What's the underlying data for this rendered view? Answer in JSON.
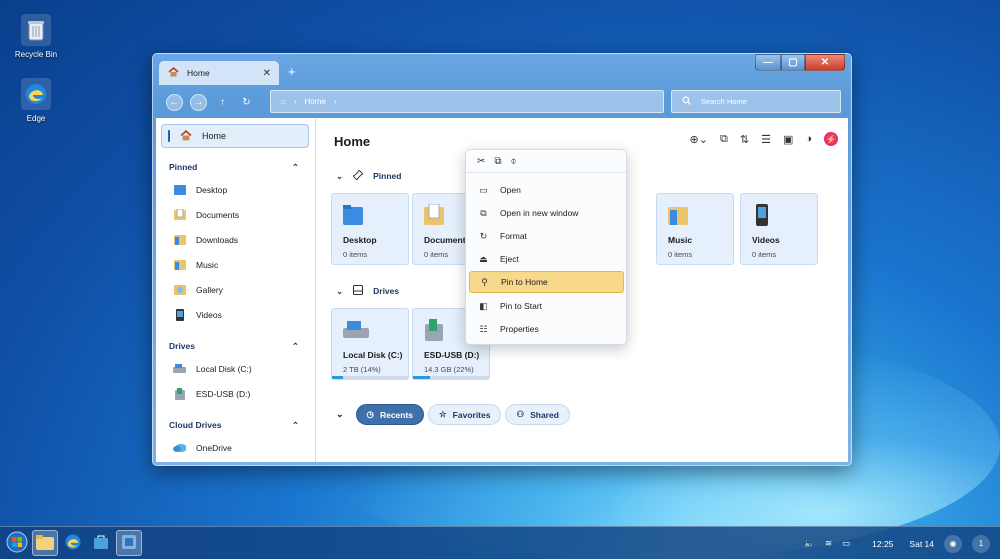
{
  "desktop": {
    "icons": [
      {
        "label": "Recycle Bin",
        "icon": "recycle-bin-icon"
      },
      {
        "label": "Edge",
        "icon": "edge-icon"
      }
    ]
  },
  "window": {
    "tab_label": "Home",
    "tab_close": "✕",
    "new_tab": "+",
    "controls": {
      "minimize": "—",
      "maximize": "▢",
      "close": "✕"
    }
  },
  "navbar": {
    "breadcrumb_sep1": "›",
    "breadcrumb": "Home",
    "breadcrumb_sep2": "›",
    "search_placeholder": "Search Home"
  },
  "sidebar": {
    "home": "Home",
    "pinned_header": "Pinned",
    "pinned": [
      "Desktop",
      "Documents",
      "Downloads",
      "Music",
      "Gallery",
      "Videos"
    ],
    "drives_header": "Drives",
    "drives": [
      "Local Disk (C:)",
      "ESD-USB (D:)"
    ],
    "cloud_header": "Cloud Drives",
    "cloud": [
      "OneDrive"
    ],
    "chevron": "⌃"
  },
  "main": {
    "title": "Home",
    "pinned_header": "Pinned",
    "drives_header": "Drives",
    "pinned_cards": [
      {
        "name": "Desktop",
        "sub": "0 items"
      },
      {
        "name": "Documents",
        "sub": "0 items"
      },
      {
        "name": "Music",
        "sub": "0 items"
      },
      {
        "name": "Videos",
        "sub": "0 items"
      }
    ],
    "drive_cards": [
      {
        "name": "Local Disk (C:)",
        "sub": "2 TB (14%)",
        "usage": 0.14
      },
      {
        "name": "ESD-USB (D:)",
        "sub": "14.3 GB (22%)",
        "usage": 0.22
      }
    ],
    "pills": {
      "recents": "Recents",
      "favorites": "Favorites",
      "shared": "Shared"
    },
    "collapse": "⌄"
  },
  "context_menu": {
    "items": [
      "Open",
      "Open in new window",
      "Format",
      "Eject",
      "Pin to Home",
      "Pin to Start",
      "Properties"
    ],
    "highlighted": "Pin to Home"
  },
  "taskbar": {
    "time": "12:25",
    "date": "Sat 14",
    "notification_count": "1"
  },
  "colors": {
    "accent": "#3f70aa",
    "highlight": "#f8d98b",
    "close": "#c9402a"
  }
}
